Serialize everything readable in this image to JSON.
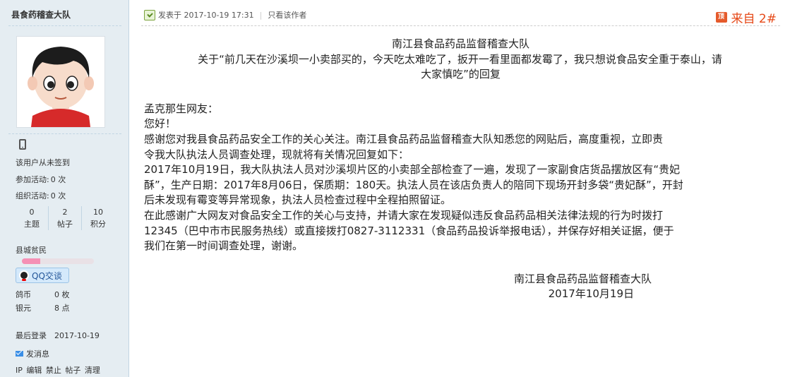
{
  "profile": {
    "username": "县食药稽查大队",
    "checkin": "该用户从未签到",
    "activities_joined_label": "参加活动:",
    "activities_joined_value": "0 次",
    "activities_organized_label": "组织活动:",
    "activities_organized_value": "0 次",
    "stats": [
      {
        "num": "0",
        "label": "主题"
      },
      {
        "num": "2",
        "label": "帖子"
      },
      {
        "num": "10",
        "label": "积分"
      }
    ],
    "rank": "县城贫民",
    "rank_progress": 0.25,
    "qq_button": "QQ交谈",
    "gold_label": "鸽币",
    "gold_value": "0 枚",
    "silver_label": "银元",
    "silver_value": "8 点",
    "last_login_label": "最后登录",
    "last_login_value": "2017-10-19",
    "send_message": "发消息",
    "tools": "IP 编辑 禁止 帖子 清理"
  },
  "post": {
    "posted_at": "发表于 2017-10-19 17:31",
    "only_author": "只看该作者",
    "top_badge": "顶",
    "floor": "来自 2#",
    "title_org": "南江县食品药品监督稽查大队",
    "title_lines": [
      "关于“前几天在沙溪坝一小卖部买的，今天吃太难吃了，扳开一看里面都发霉了，我只想说食品安全重于泰山，请",
      "大家慎吃”的回复"
    ],
    "body_lines": [
      "孟克那生网友：",
      "您好！",
      "感谢您对我县食品药品安全工作的关心关注。南江县食品药品监督稽查大队知悉您的网贴后，高度重视，立即责",
      "令我大队执法人员调查处理，现就将有关情况回复如下：",
      "2017年10月19日，我大队执法人员对沙溪坝片区的小卖部全部检查了一遍，发现了一家副食店货品摆放区有“贵妃",
      "酥”，生产日期：2017年8月06日，保质期：180天。执法人员在该店负责人的陪同下现场开封多袋“贵妃酥”，开封",
      "后未发现有霉变等异常现象，执法人员检查过程中全程拍照留证。",
      "在此感谢广大网友对食品安全工作的关心与支持，并请大家在发现疑似违反食品药品相关法律法规的行为时拨打",
      "12345（巴中市市民服务热线）或直接拨打0827-3112331（食品药品投诉举报电话），并保存好相关证据，便于",
      "我们在第一时间调查处理，谢谢。"
    ],
    "signature_org": "南江县食品药品监督稽查大队",
    "signature_date": "2017年10月19日"
  }
}
